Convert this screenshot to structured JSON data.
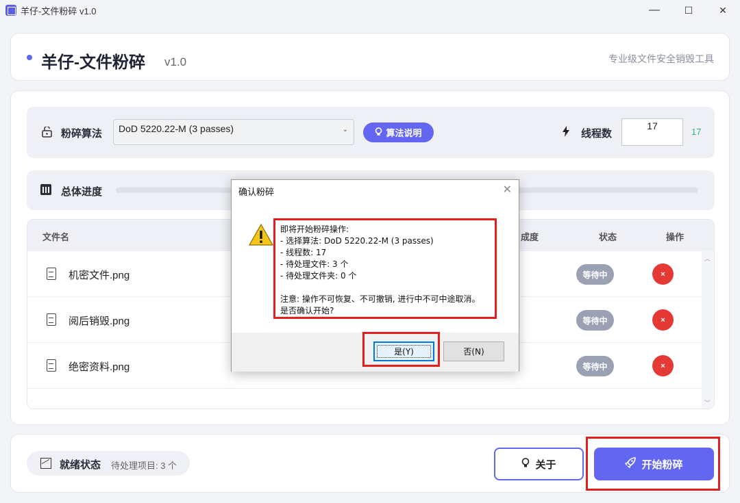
{
  "window": {
    "title": "羊仔-文件粉碎 v1.0",
    "controls": {
      "minimize": "—",
      "maximize": "☐",
      "close": "✕"
    }
  },
  "header": {
    "title": "羊仔-文件粉碎",
    "version": "v1.0",
    "subtitle": "专业级文件安全销毁工具"
  },
  "algorithm": {
    "label": "粉碎算法",
    "selected": "DoD 5220.22-M (3 passes)",
    "help_button": "算法说明",
    "help_icon": "lightbulb-icon"
  },
  "threads": {
    "label": "线程数",
    "input_value": "17",
    "display_value": "17"
  },
  "progress": {
    "label": "总体进度",
    "value": 0
  },
  "table": {
    "columns": {
      "name": "文件名",
      "progress_partial": "成度",
      "status": "状态",
      "action": "操作"
    },
    "rows": [
      {
        "name": "机密文件.png",
        "status": "等待中",
        "action": "×"
      },
      {
        "name": "阅后销毁.png",
        "status": "等待中",
        "action": "×"
      },
      {
        "name": "绝密资料.png",
        "status": "等待中",
        "action": "×"
      }
    ]
  },
  "footer": {
    "status_title": "就绪状态",
    "status_count": "待处理项目: 3 个",
    "about_button": "关于",
    "start_button": "开始粉碎"
  },
  "dialog": {
    "title": "确认粉碎",
    "close": "✕",
    "lines": [
      "即将开始粉碎操作:",
      "- 选择算法: DoD 5220.22-M (3 passes)",
      "- 线程数: 17",
      "- 待处理文件: 3 个",
      "- 待处理文件夹: 0 个",
      "",
      "注意: 操作不可恢复、不可撤销, 进行中不可中途取消。",
      "是否确认开始?"
    ],
    "yes_button": "是(Y)",
    "no_button": "否(N)"
  },
  "colors": {
    "accent": "#6366f1",
    "danger": "#e53935",
    "highlight": "#e02020",
    "success": "#2bb673"
  }
}
